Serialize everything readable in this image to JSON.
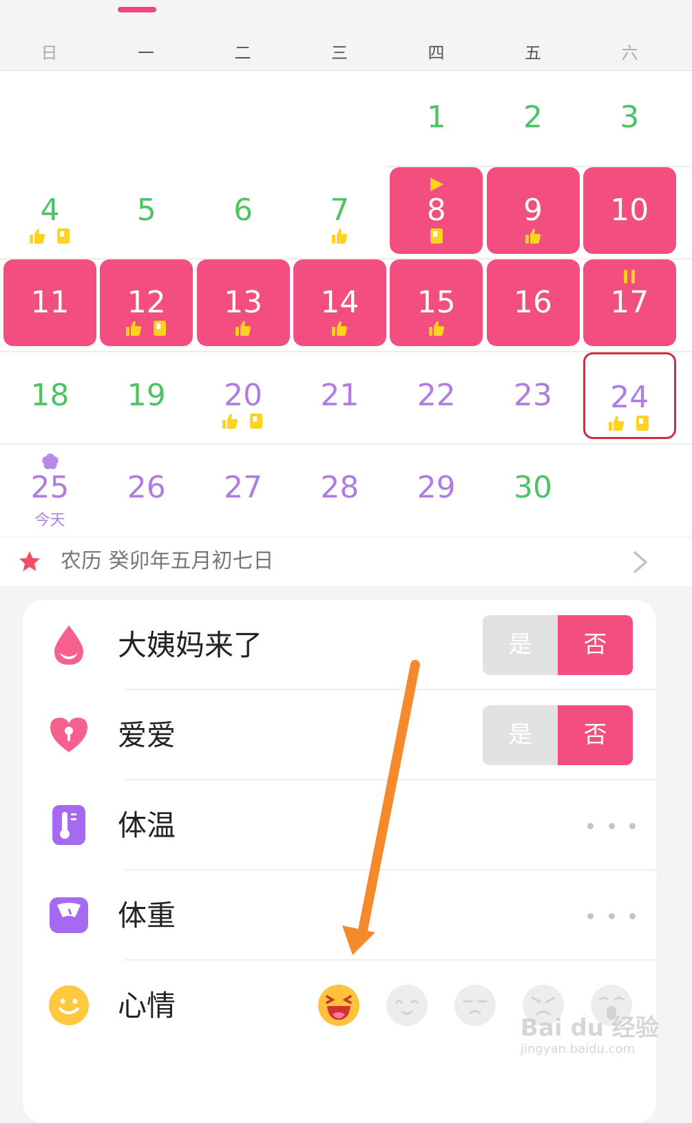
{
  "weekdays": [
    "日",
    "一",
    "二",
    "三",
    "四",
    "五",
    "六"
  ],
  "calendar": {
    "rows": [
      [
        null,
        null,
        null,
        null,
        {
          "num": "1",
          "style": "green"
        },
        {
          "num": "2",
          "style": "green"
        },
        {
          "num": "3",
          "style": "green"
        }
      ],
      [
        {
          "num": "4",
          "style": "green",
          "icons": [
            "thumb",
            "note"
          ]
        },
        {
          "num": "5",
          "style": "green"
        },
        {
          "num": "6",
          "style": "green"
        },
        {
          "num": "7",
          "style": "green",
          "icons": [
            "thumb"
          ]
        },
        {
          "num": "8",
          "style": "period",
          "icons": [
            "note"
          ],
          "top": "start"
        },
        {
          "num": "9",
          "style": "period",
          "icons": [
            "thumb"
          ]
        },
        {
          "num": "10",
          "style": "period"
        }
      ],
      [
        {
          "num": "11",
          "style": "period"
        },
        {
          "num": "12",
          "style": "period",
          "icons": [
            "thumb",
            "note"
          ]
        },
        {
          "num": "13",
          "style": "period",
          "icons": [
            "thumb"
          ]
        },
        {
          "num": "14",
          "style": "period",
          "icons": [
            "thumb"
          ]
        },
        {
          "num": "15",
          "style": "period",
          "icons": [
            "thumb"
          ]
        },
        {
          "num": "16",
          "style": "period"
        },
        {
          "num": "17",
          "style": "period",
          "top": "pause"
        }
      ],
      [
        {
          "num": "18",
          "style": "green"
        },
        {
          "num": "19",
          "style": "green"
        },
        {
          "num": "20",
          "style": "purple",
          "icons": [
            "thumb",
            "note"
          ]
        },
        {
          "num": "21",
          "style": "purple"
        },
        {
          "num": "22",
          "style": "purple"
        },
        {
          "num": "23",
          "style": "purple"
        },
        {
          "num": "24",
          "style": "purple",
          "icons": [
            "thumb",
            "note"
          ],
          "selected": true
        }
      ],
      [
        {
          "num": "25",
          "style": "purple",
          "top": "flower",
          "today": "今天"
        },
        {
          "num": "26",
          "style": "purple"
        },
        {
          "num": "27",
          "style": "purple"
        },
        {
          "num": "28",
          "style": "purple"
        },
        {
          "num": "29",
          "style": "purple"
        },
        {
          "num": "30",
          "style": "green"
        },
        null
      ]
    ]
  },
  "lunar": {
    "text": "农历 癸卯年五月初七日",
    "icon": "star-icon"
  },
  "records": [
    {
      "id": "period",
      "label": "大姨妈来了",
      "icon": "drop-icon",
      "control": "toggle",
      "yes": "是",
      "no": "否",
      "value": "否"
    },
    {
      "id": "love",
      "label": "爱爱",
      "icon": "heart-icon",
      "control": "toggle",
      "yes": "是",
      "no": "否",
      "value": "否"
    },
    {
      "id": "temperature",
      "label": "体温",
      "icon": "thermometer-icon",
      "control": "more"
    },
    {
      "id": "weight",
      "label": "体重",
      "icon": "scale-icon",
      "control": "more"
    },
    {
      "id": "mood",
      "label": "心情",
      "icon": "smiley-icon",
      "control": "moods",
      "moods": [
        "excited-face-icon",
        "happy-face-icon",
        "meh-face-icon",
        "angry-face-icon",
        "crying-face-icon"
      ],
      "selected_mood": 0
    }
  ],
  "colors": {
    "accent": "#f24e80",
    "green": "#4cc463",
    "purple": "#b07ce3",
    "arrow": "#f58a2b"
  },
  "watermark": {
    "brand": "Bai du 经验",
    "url": "jingyan.baidu.com"
  }
}
